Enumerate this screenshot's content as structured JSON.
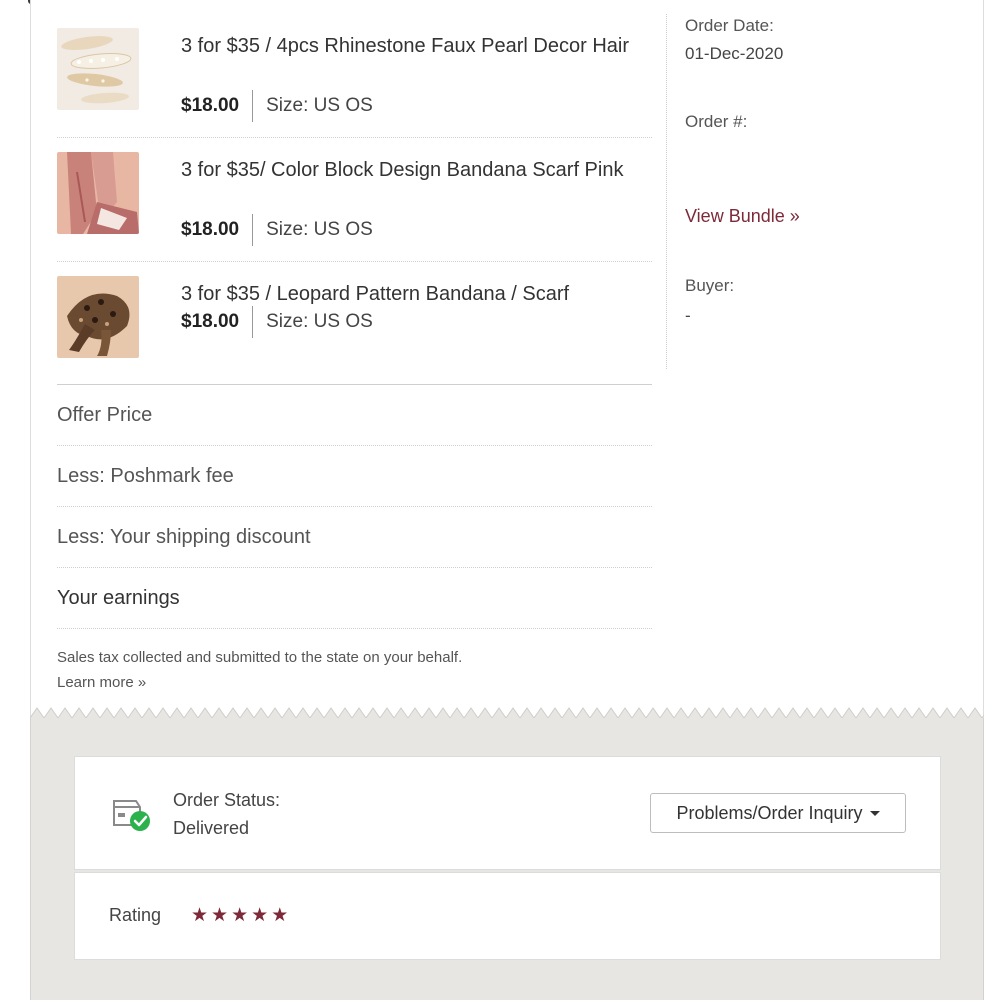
{
  "items": [
    {
      "title": "3 for $35 / 4pcs Rhinestone Faux Pearl Decor Hair",
      "price": "$18.00",
      "size": "Size: US OS",
      "thumb_icon": "hair-clips-photo"
    },
    {
      "title": "3 for $35/ Color Block Design Bandana Scarf Pink",
      "price": "$18.00",
      "size": "Size: US OS",
      "thumb_icon": "pink-scarf-photo"
    },
    {
      "title": "3 for $35 / Leopard Pattern Bandana / Scarf",
      "price": "$18.00",
      "size": "Size: US OS",
      "thumb_icon": "leopard-scarf-photo"
    }
  ],
  "order": {
    "date_label": "Order Date:",
    "date_value": "01-Dec-2020",
    "number_label": "Order #:",
    "view_bundle": "View Bundle »",
    "buyer_label": "Buyer:",
    "buyer_value": "-"
  },
  "summary": {
    "offer_price": "Offer Price",
    "poshmark_fee": "Less: Poshmark fee",
    "shipping_discount": "Less: Your shipping discount",
    "earnings": "Your earnings",
    "tax_note": "Sales tax collected and submitted to the state on your behalf.",
    "learn_more": "Learn more »"
  },
  "status": {
    "label": "Order Status:",
    "value": "Delivered",
    "icon": "package-delivered-icon",
    "inquiry_button": "Problems/Order Inquiry"
  },
  "rating": {
    "label": "Rating",
    "stars": "★★★★★",
    "value": 5,
    "max": 5
  },
  "colors": {
    "accent": "#7d2938",
    "status_green": "#2bb24c",
    "footer_bg": "#e8e6e3"
  }
}
